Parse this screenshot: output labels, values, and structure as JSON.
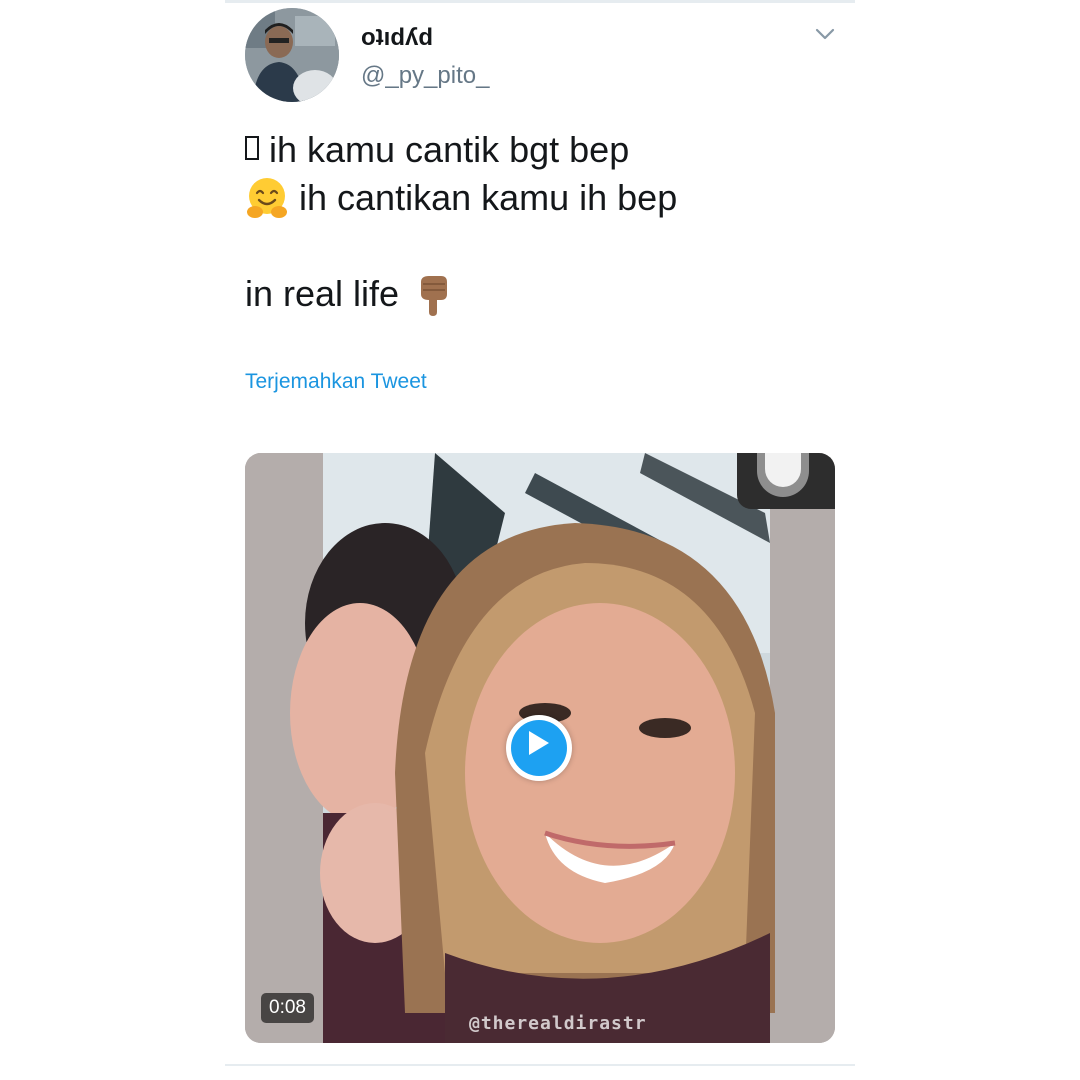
{
  "tweet": {
    "display_name": "oʇıdʎd",
    "handle": "@_py_pito_",
    "lines": [
      "ih kamu cantik bgt bep",
      "ih cantikan kamu ih bep",
      "",
      "in real life"
    ],
    "translate_label": "Terjemahkan Tweet"
  },
  "media": {
    "duration": "0:08",
    "watermark": "@therealdirastr"
  },
  "icons": {
    "menu": "chevron-down-icon",
    "missing_glyph": "missing-glyph-icon",
    "hug": "hugging-face-emoji",
    "point_down": "backhand-index-pointing-down-emoji",
    "play": "play-icon"
  },
  "colors": {
    "link": "#1b95e0",
    "play_accent": "#1da1f2",
    "text": "#14171a",
    "secondary": "#657786"
  }
}
